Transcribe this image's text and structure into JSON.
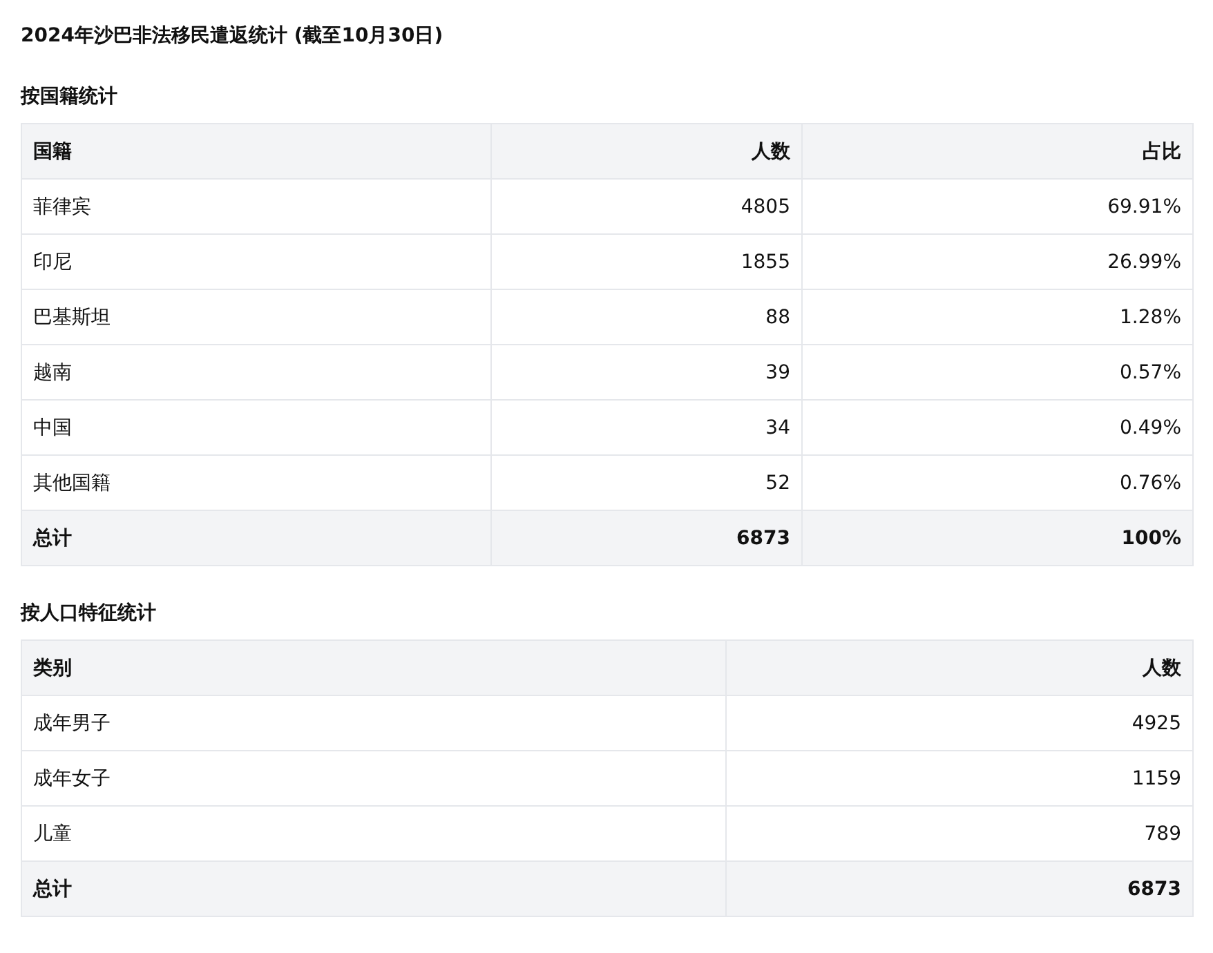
{
  "title": "2024年沙巴非法移民遣返统计 (截至10月30日)",
  "sections": [
    {
      "heading": "按国籍统计",
      "columns": [
        "国籍",
        "人数",
        "占比"
      ],
      "rows": [
        [
          "菲律宾",
          "4805",
          "69.91%"
        ],
        [
          "印尼",
          "1855",
          "26.99%"
        ],
        [
          "巴基斯坦",
          "88",
          "1.28%"
        ],
        [
          "越南",
          "39",
          "0.57%"
        ],
        [
          "中国",
          "34",
          "0.49%"
        ],
        [
          "其他国籍",
          "52",
          "0.76%"
        ]
      ],
      "total": [
        "总计",
        "6873",
        "100%"
      ]
    },
    {
      "heading": "按人口特征统计",
      "columns": [
        "类别",
        "人数"
      ],
      "rows": [
        [
          "成年男子",
          "4925"
        ],
        [
          "成年女子",
          "1159"
        ],
        [
          "儿童",
          "789"
        ]
      ],
      "total": [
        "总计",
        "6873"
      ]
    }
  ]
}
